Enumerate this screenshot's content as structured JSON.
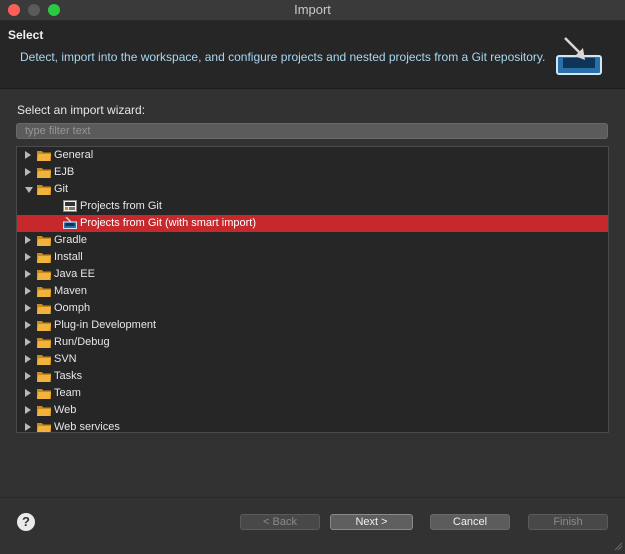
{
  "window": {
    "title": "Import"
  },
  "header": {
    "title": "Select",
    "description": "Detect, import into the workspace, and configure projects and nested projects from a Git repository."
  },
  "wizard": {
    "label": "Select an import wizard:",
    "filter_placeholder": "type filter text",
    "filter_value": ""
  },
  "tree": {
    "items": [
      {
        "label": "General",
        "level": 0,
        "state": "collapsed",
        "icon": "folder-icon"
      },
      {
        "label": "EJB",
        "level": 0,
        "state": "collapsed",
        "icon": "folder-icon"
      },
      {
        "label": "Git",
        "level": 0,
        "state": "expanded",
        "icon": "folder-icon"
      },
      {
        "label": "Projects from Git",
        "level": 1,
        "state": "leaf",
        "icon": "git-icon"
      },
      {
        "label": "Projects from Git (with smart import)",
        "level": 1,
        "state": "leaf",
        "icon": "smart-import-icon",
        "selected": true
      },
      {
        "label": "Gradle",
        "level": 0,
        "state": "collapsed",
        "icon": "folder-icon"
      },
      {
        "label": "Install",
        "level": 0,
        "state": "collapsed",
        "icon": "folder-icon"
      },
      {
        "label": "Java EE",
        "level": 0,
        "state": "collapsed",
        "icon": "folder-icon"
      },
      {
        "label": "Maven",
        "level": 0,
        "state": "collapsed",
        "icon": "folder-icon"
      },
      {
        "label": "Oomph",
        "level": 0,
        "state": "collapsed",
        "icon": "folder-icon"
      },
      {
        "label": "Plug-in Development",
        "level": 0,
        "state": "collapsed",
        "icon": "folder-icon"
      },
      {
        "label": "Run/Debug",
        "level": 0,
        "state": "collapsed",
        "icon": "folder-icon"
      },
      {
        "label": "SVN",
        "level": 0,
        "state": "collapsed",
        "icon": "folder-icon"
      },
      {
        "label": "Tasks",
        "level": 0,
        "state": "collapsed",
        "icon": "folder-icon"
      },
      {
        "label": "Team",
        "level": 0,
        "state": "collapsed",
        "icon": "folder-icon"
      },
      {
        "label": "Web",
        "level": 0,
        "state": "collapsed",
        "icon": "folder-icon"
      },
      {
        "label": "Web services",
        "level": 0,
        "state": "collapsed",
        "icon": "folder-icon"
      }
    ]
  },
  "buttons": {
    "help": "?",
    "back": "< Back",
    "next": "Next >",
    "cancel": "Cancel",
    "finish": "Finish"
  },
  "colors": {
    "selection": "#c7282c",
    "description": "#a9d7f0"
  }
}
